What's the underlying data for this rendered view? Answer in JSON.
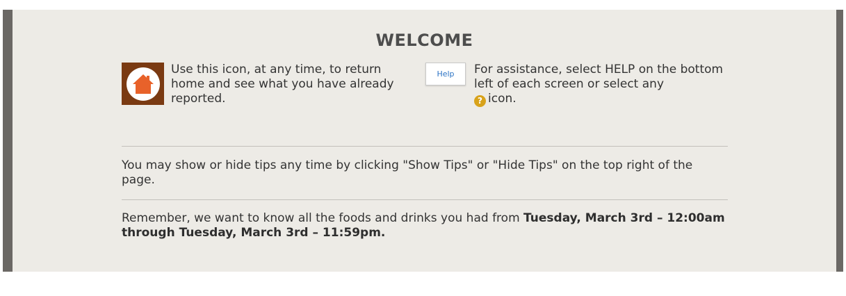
{
  "welcome": {
    "title": "WELCOME"
  },
  "home_info": {
    "icon": "home-icon",
    "text": "Use this icon, at any time, to return home and see what you have already reported."
  },
  "help_info": {
    "button_label": "Help",
    "text_before_icon": "For assistance, select HELP on the bottom left of each screen or select any",
    "icon_glyph": "?",
    "text_after_icon": "icon."
  },
  "tips_info": {
    "text": "You may show or hide tips any time by clicking \"Show Tips\" or \"Hide Tips\" on the top right of the page."
  },
  "reminder": {
    "text_prefix": "Remember, we want to know all the foods and drinks you had from ",
    "date_range": "Tuesday, March 3rd – 12:00am through Tuesday, March 3rd – 11:59pm."
  },
  "colors": {
    "panel_background": "#edebe6",
    "panel_border": "#6b6865",
    "home_icon_background": "#7a3a12",
    "home_icon_house": "#e8622a",
    "help_icon": "#d8a21a",
    "help_button_text": "#2b73c4"
  }
}
